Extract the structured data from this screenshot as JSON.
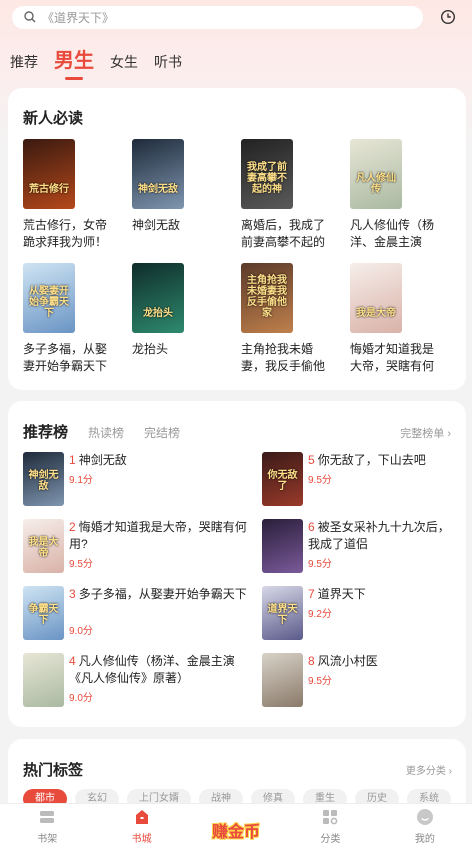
{
  "search": {
    "placeholder": "《道界天下》"
  },
  "tabs": [
    {
      "label": "推荐"
    },
    {
      "label": "男生"
    },
    {
      "label": "女生"
    },
    {
      "label": "听书"
    }
  ],
  "new_reads": {
    "title": "新人必读",
    "books": [
      {
        "title": "荒古修行，女帝跪求拜我为师！",
        "cover_text": "荒古修行",
        "colors": [
          "#3a1a10",
          "#b5481a"
        ]
      },
      {
        "title": "神剑无敌",
        "cover_text": "神剑无敌",
        "colors": [
          "#1e2a3a",
          "#7f96b0"
        ]
      },
      {
        "title": "离婚后，我成了前妻高攀不起的神",
        "cover_text": "我成了前妻高攀不起的神",
        "colors": [
          "#222222",
          "#5a5a5a"
        ]
      },
      {
        "title": "凡人修仙传（杨洋、金晨主演《凡人修…",
        "cover_text": "凡人修仙传",
        "colors": [
          "#e8e6d6",
          "#a9b9a2"
        ]
      },
      {
        "title": "多子多福，从娶妻开始争霸天下",
        "cover_text": "从娶妻开始争霸天下",
        "colors": [
          "#cfe4f3",
          "#6a94c4"
        ]
      },
      {
        "title": "龙抬头",
        "cover_text": "龙抬头",
        "colors": [
          "#0f2c2a",
          "#2e8a6d"
        ]
      },
      {
        "title": "主角抢我未婚妻，我反手偷他家",
        "cover_text": "主角抢我未婚妻我反手偷他家",
        "colors": [
          "#5a3a2a",
          "#c0804c"
        ]
      },
      {
        "title": "悔婚才知道我是大帝，哭瞎有何用？",
        "cover_text": "我是大帝",
        "colors": [
          "#f6eeea",
          "#d9b2a8"
        ]
      }
    ]
  },
  "ranking": {
    "title": "推荐榜",
    "tabs": [
      "热读榜",
      "完结榜"
    ],
    "more": "完整榜单 ›",
    "items": [
      {
        "num": "1",
        "name": "神剑无敌",
        "score": "9.1分",
        "colors": [
          "#1e2a3a",
          "#7f96b0"
        ],
        "cover_text": "神剑无敌"
      },
      {
        "num": "5",
        "name": "你无敌了，下山去吧",
        "score": "9.5分",
        "colors": [
          "#3a1a18",
          "#9a3a2a"
        ],
        "cover_text": "你无敌了"
      },
      {
        "num": "2",
        "name": "悔婚才知道我是大帝，哭瞎有何用?",
        "score": "9.5分",
        "colors": [
          "#f6eeea",
          "#d9b2a8"
        ],
        "cover_text": "我是大帝"
      },
      {
        "num": "6",
        "name": "被圣女采补九十九次后，我成了道侣",
        "score": "9.5分",
        "colors": [
          "#2a1e3a",
          "#7a5a9a"
        ],
        "cover_text": ""
      },
      {
        "num": "3",
        "name": "多子多福，从娶妻开始争霸天下",
        "score": "9.0分",
        "colors": [
          "#cfe4f3",
          "#6a94c4"
        ],
        "cover_text": "争霸天下"
      },
      {
        "num": "7",
        "name": "道界天下",
        "score": "9.2分",
        "colors": [
          "#d8d8e8",
          "#5a5a8a"
        ],
        "cover_text": "道界天下"
      },
      {
        "num": "4",
        "name": "凡人修仙传（杨洋、金晨主演《凡人修仙传》原著）",
        "score": "9.0分",
        "colors": [
          "#e8e6d6",
          "#a9b9a2"
        ],
        "cover_text": ""
      },
      {
        "num": "8",
        "name": "风流小村医",
        "score": "9.5分",
        "colors": [
          "#d8d2c8",
          "#8a7a6a"
        ],
        "cover_text": ""
      }
    ]
  },
  "hot_tags": {
    "title": "热门标签",
    "more": "更多分类 ›",
    "tags": [
      "都市",
      "玄幻",
      "上门女婿",
      "战神",
      "修真",
      "重生",
      "历史",
      "系统"
    ]
  },
  "bottom_nav": {
    "items": [
      {
        "label": "书架",
        "icon": "bookshelf-icon"
      },
      {
        "label": "书城",
        "icon": "bookstore-icon"
      },
      {
        "label": "赚金币",
        "icon": "earn-coins-icon"
      },
      {
        "label": "分类",
        "icon": "category-icon"
      },
      {
        "label": "我的",
        "icon": "profile-icon"
      }
    ]
  },
  "colors": {
    "accent": "#e84a3c",
    "muted": "#999999"
  }
}
